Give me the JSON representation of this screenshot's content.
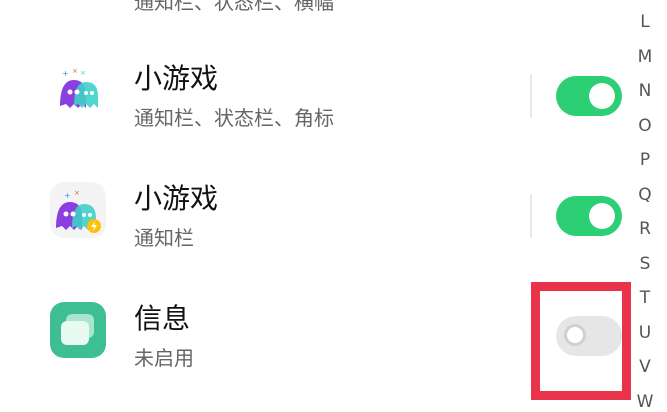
{
  "list": {
    "partial_top": {
      "subtitle": "通知栏、状态栏、横幅"
    },
    "items": [
      {
        "title": "小游戏",
        "subtitle": "通知栏、状态栏、角标",
        "enabled": true
      },
      {
        "title": "小游戏",
        "subtitle": "通知栏",
        "enabled": true
      },
      {
        "title": "信息",
        "subtitle": "未启用",
        "enabled": false
      }
    ]
  },
  "alphabet_index": [
    "L",
    "M",
    "N",
    "O",
    "P",
    "Q",
    "R",
    "S",
    "T",
    "U",
    "V",
    "W"
  ],
  "colors": {
    "toggle_on": "#2ccf74",
    "toggle_off": "#e6e6e6",
    "highlight": "#e8334a",
    "messages_icon": "#3dbf93"
  }
}
